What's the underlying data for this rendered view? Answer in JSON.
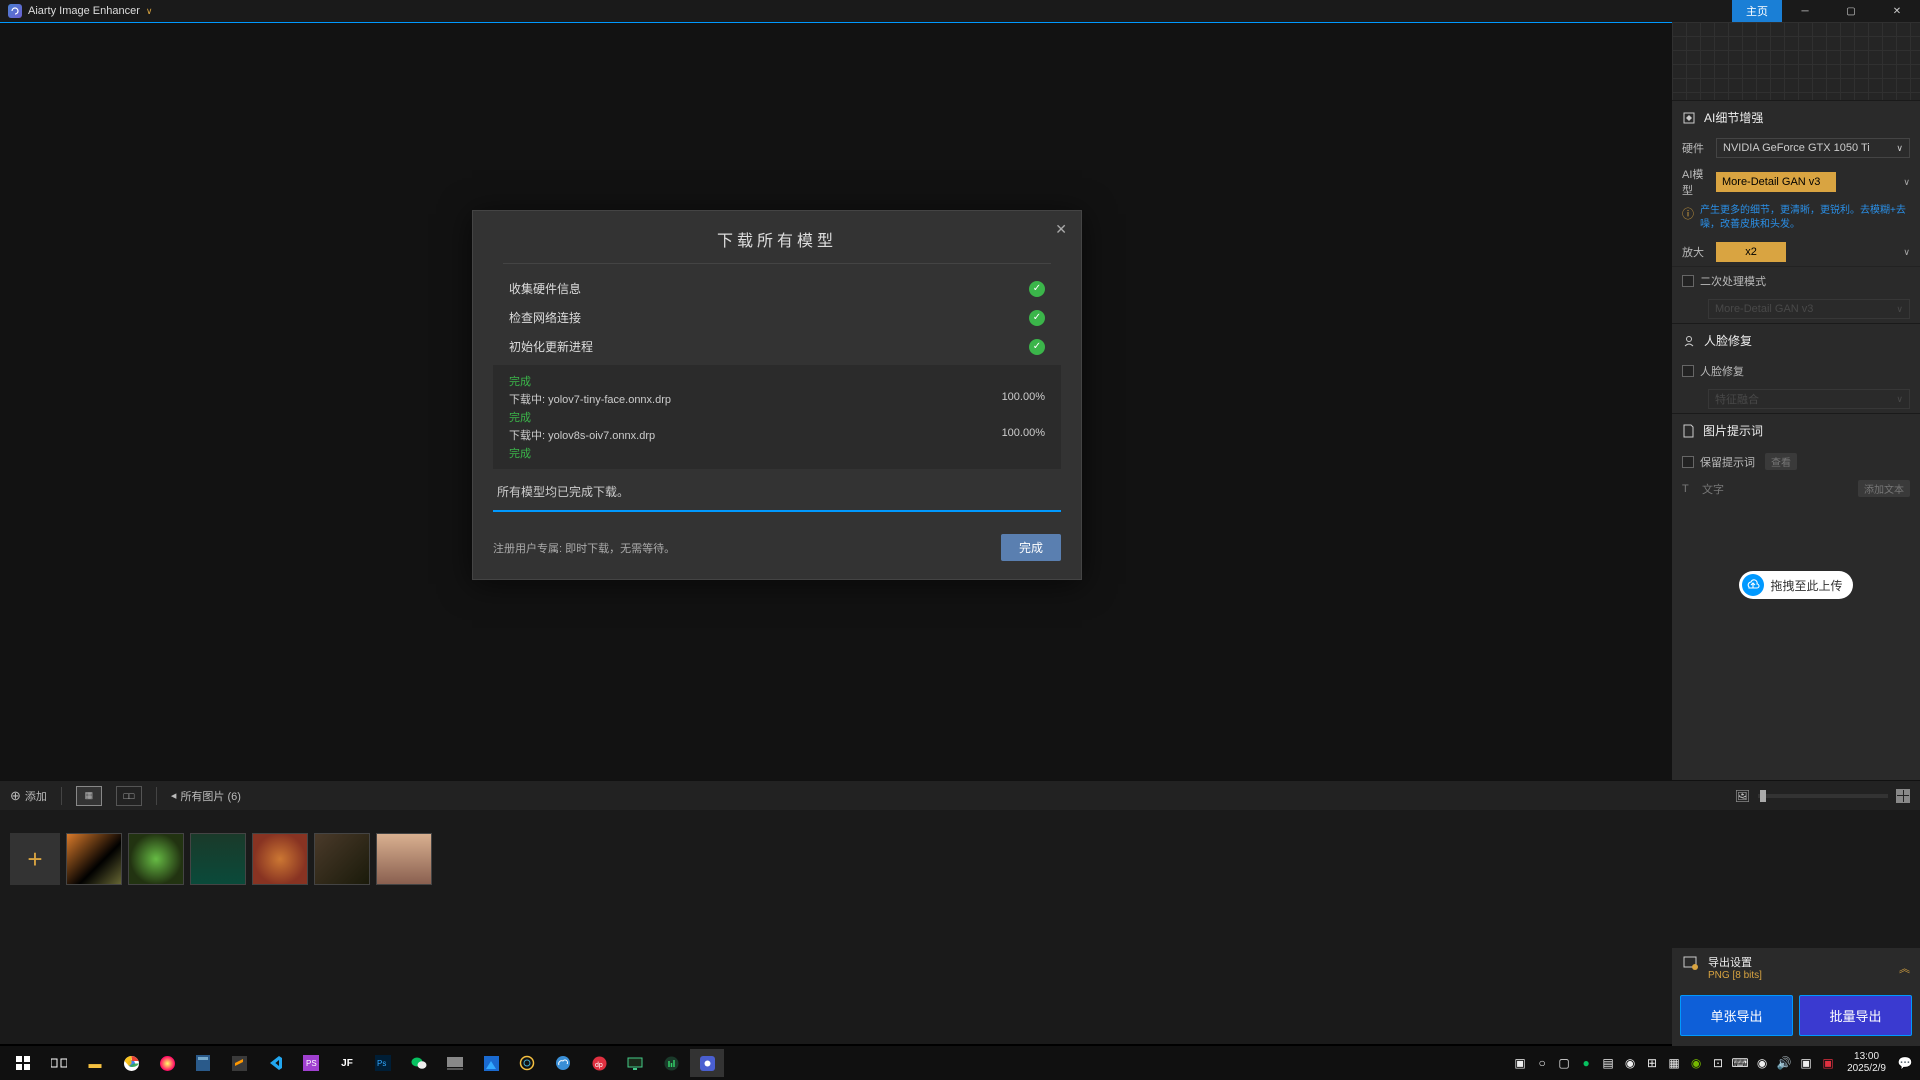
{
  "titlebar": {
    "app_name": "Aiarty Image Enhancer",
    "home_label": "主页"
  },
  "modal": {
    "title": "下载所有模型",
    "steps": {
      "s1": "收集硬件信息",
      "s2": "检查网络连接",
      "s3": "初始化更新进程"
    },
    "done_word": "完成",
    "dl1_name": "下载中: yolov7-tiny-face.onnx.drp",
    "dl1_pct": "100.00%",
    "dl2_name": "下载中: yolov8s-oiv7.onnx.drp",
    "dl2_pct": "100.00%",
    "summary": "所有模型均已完成下载。",
    "footer_note": "注册用户专属: 即时下载，无需等待。",
    "done_btn": "完成"
  },
  "panel": {
    "sec_ai": "AI细节增强",
    "hw_label": "硬件",
    "hw_value": "NVIDIA GeForce GTX 1050 Ti",
    "model_label": "AI模型",
    "model_value": "More-Detail GAN  v3",
    "hint": "产生更多的细节，更清晰，更锐利。去模糊+去噪，改善皮肤和头发。",
    "scale_label": "放大",
    "scale_value": "x2",
    "second_label": "二次处理模式",
    "second_value": "More-Detail GAN  v3",
    "sec_face": "人脸修复",
    "face_check": "人脸修复",
    "face_value": "特征融合",
    "sec_prompt": "图片提示词",
    "keep_label": "保留提示词",
    "view_btn": "查看",
    "text_label": "文字",
    "add_text_btn": "添加文本",
    "upload_label": "拖拽至此上传"
  },
  "bottom": {
    "add": "添加",
    "all_images": "所有图片 (6)"
  },
  "export": {
    "title": "导出设置",
    "sub": "PNG   [8 bits]",
    "single": "单张导出",
    "batch": "批量导出"
  },
  "taskbar": {
    "time": "13:00",
    "date": "2025/2/9"
  }
}
